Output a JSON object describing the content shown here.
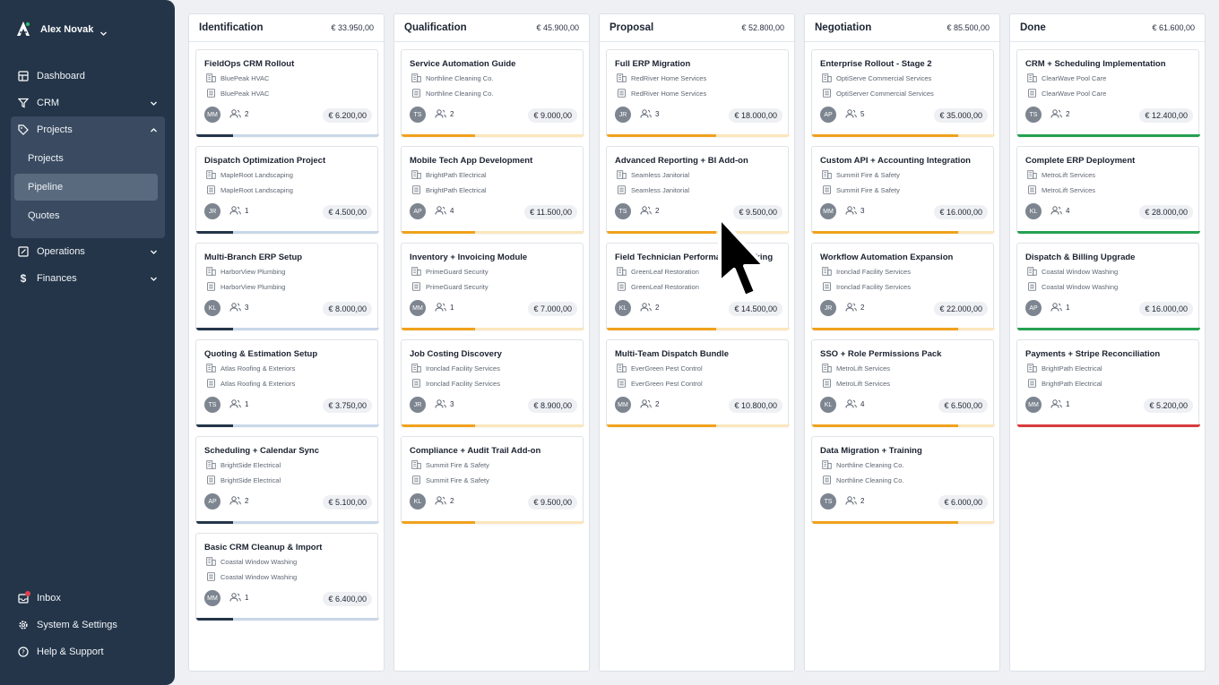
{
  "user": {
    "name": "Alex Novak"
  },
  "nav": [
    {
      "label": "Dashboard",
      "icon": "dashboard-icon"
    },
    {
      "label": "CRM",
      "icon": "filter-icon"
    },
    {
      "label": "Projects",
      "icon": "tag-icon",
      "children": [
        "Projects",
        "Pipeline",
        "Quotes"
      ],
      "active_child": "Pipeline"
    },
    {
      "label": "Operations",
      "icon": "edit-icon"
    },
    {
      "label": "Finances",
      "icon": "dollar-icon"
    }
  ],
  "bottom_nav": [
    {
      "label": "Inbox",
      "icon": "inbox-icon"
    },
    {
      "label": "System & Settings",
      "icon": "gear-icon"
    },
    {
      "label": "Help & Support",
      "icon": "help-icon"
    }
  ],
  "colors": {
    "sidebar": "#243549",
    "dark": "#243549",
    "orange": "#f0a21d",
    "green": "#25a150",
    "red": "#d93a3f"
  },
  "columns": [
    {
      "title": "Identification",
      "total": "€ 33.950,00",
      "cards": [
        {
          "title": "FieldOps CRM Rollout",
          "company": "BluePeak HVAC",
          "contact": "BluePeak HVAC",
          "initials": "MM",
          "people": "2",
          "value": "€ 6.200,00",
          "color": "dark",
          "progress": 0.2
        },
        {
          "title": "Dispatch Optimization Project",
          "company": "MapleRoot Landscaping",
          "contact": "MapleRoot Landscaping",
          "initials": "JR",
          "people": "1",
          "value": "€ 4.500,00",
          "color": "dark",
          "progress": 0.2
        },
        {
          "title": "Multi-Branch ERP Setup",
          "company": "HarborView Plumbing",
          "contact": "HarborView Plumbing",
          "initials": "KL",
          "people": "3",
          "value": "€ 8.000,00",
          "color": "dark",
          "progress": 0.2
        },
        {
          "title": "Quoting & Estimation Setup",
          "company": "Atlas Roofing & Exteriors",
          "contact": "Atlas Roofing & Exteriors",
          "initials": "TS",
          "people": "1",
          "value": "€ 3.750,00",
          "color": "dark",
          "progress": 0.2
        },
        {
          "title": "Scheduling + Calendar Sync",
          "company": "BrightSide Electrical",
          "contact": "BrightSide Electrical",
          "initials": "AP",
          "people": "2",
          "value": "€ 5.100,00",
          "color": "dark",
          "progress": 0.2
        },
        {
          "title": "Basic CRM Cleanup & Import",
          "company": "Coastal Window Washing",
          "contact": "Coastal Window Washing",
          "initials": "MM",
          "people": "1",
          "value": "€ 6.400,00",
          "color": "dark",
          "progress": 0.2
        }
      ]
    },
    {
      "title": "Qualification",
      "total": "€ 45.900,00",
      "cards": [
        {
          "title": "Service Automation Guide",
          "company": "Northline Cleaning Co.",
          "contact": "Northline Cleaning Co.",
          "initials": "TS",
          "people": "2",
          "value": "€ 9.000,00",
          "color": "orange",
          "progress": 0.4
        },
        {
          "title": "Mobile Tech App Development",
          "company": "BrightPath Electrical",
          "contact": "BrightPath Electrical",
          "initials": "AP",
          "people": "4",
          "value": "€ 11.500,00",
          "color": "orange",
          "progress": 0.4
        },
        {
          "title": "Inventory + Invoicing Module",
          "company": "PrimeGuard Security",
          "contact": "PrimeGuard Security",
          "initials": "MM",
          "people": "1",
          "value": "€ 7.000,00",
          "color": "orange",
          "progress": 0.4
        },
        {
          "title": "Job Costing Discovery",
          "company": "Ironclad Facility Services",
          "contact": "Ironclad Facility Services",
          "initials": "JR",
          "people": "3",
          "value": "€ 8.900,00",
          "color": "orange",
          "progress": 0.4
        },
        {
          "title": "Compliance + Audit Trail Add-on",
          "company": "Summit Fire & Safety",
          "contact": "Summit Fire & Safety",
          "initials": "KL",
          "people": "2",
          "value": "€ 9.500,00",
          "color": "orange",
          "progress": 0.4
        }
      ]
    },
    {
      "title": "Proposal",
      "total": "€ 52.800,00",
      "cards": [
        {
          "title": "Full ERP Migration",
          "company": "RedRiver Home Services",
          "contact": "RedRiver Home Services",
          "initials": "JR",
          "people": "3",
          "value": "€ 18.000,00",
          "color": "orange",
          "progress": 0.6
        },
        {
          "title": "Advanced Reporting + BI Add-on",
          "company": "Seamless Janitorial",
          "contact": "Seamless Janitorial",
          "initials": "TS",
          "people": "2",
          "value": "€ 9.500,00",
          "color": "orange",
          "progress": 0.6
        },
        {
          "title": "Field Technician Performance Tracking",
          "company": "GreenLeaf Restoration",
          "contact": "GreenLeaf Restoration",
          "initials": "KL",
          "people": "2",
          "value": "€ 14.500,00",
          "color": "orange",
          "progress": 0.6
        },
        {
          "title": "Multi-Team Dispatch Bundle",
          "company": "EverGreen Pest Control",
          "contact": "EverGreen Pest Control",
          "initials": "MM",
          "people": "2",
          "value": "€ 10.800,00",
          "color": "orange",
          "progress": 0.6
        }
      ]
    },
    {
      "title": "Negotiation",
      "total": "€ 85.500,00",
      "cards": [
        {
          "title": "Enterprise Rollout - Stage 2",
          "company": "OptiServe Commercial Services",
          "contact": "OptiServer Commercial Services",
          "initials": "AP",
          "people": "5",
          "value": "€ 35.000,00",
          "color": "orange",
          "progress": 0.8
        },
        {
          "title": "Custom API + Accounting Integration",
          "company": "Summit Fire & Safety",
          "contact": "Summit Fire & Safety",
          "initials": "MM",
          "people": "3",
          "value": "€ 16.000,00",
          "color": "orange",
          "progress": 0.8
        },
        {
          "title": "Workflow Automation Expansion",
          "company": "Ironclad Facility Services",
          "contact": "Ironclad Facility Services",
          "initials": "JR",
          "people": "2",
          "value": "€ 22.000,00",
          "color": "orange",
          "progress": 0.8
        },
        {
          "title": "SSO + Role Permissions Pack",
          "company": "MetroLift Services",
          "contact": "MetroLift Services",
          "initials": "KL",
          "people": "4",
          "value": "€ 6.500,00",
          "color": "orange",
          "progress": 0.8
        },
        {
          "title": "Data Migration + Training",
          "company": "Northline Cleaning Co.",
          "contact": "Northline Cleaning Co.",
          "initials": "TS",
          "people": "2",
          "value": "€ 6.000,00",
          "color": "orange",
          "progress": 0.8
        }
      ]
    },
    {
      "title": "Done",
      "total": "€ 61.600,00",
      "cards": [
        {
          "title": "CRM + Scheduling Implementation",
          "company": "ClearWave Pool Care",
          "contact": "ClearWave Pool Care",
          "initials": "TS",
          "people": "2",
          "value": "€ 12.400,00",
          "color": "green",
          "progress": 1
        },
        {
          "title": "Complete ERP Deployment",
          "company": "MetroLift Services",
          "contact": "MetroLift Services",
          "initials": "KL",
          "people": "4",
          "value": "€ 28.000,00",
          "color": "green",
          "progress": 1
        },
        {
          "title": "Dispatch & Billing Upgrade",
          "company": "Coastal Window Washing",
          "contact": "Coastal Window Washing",
          "initials": "AP",
          "people": "1",
          "value": "€ 16.000,00",
          "color": "green",
          "progress": 1
        },
        {
          "title": "Payments + Stripe Reconciliation",
          "company": "BrightPath Electrical",
          "contact": "BrightPath Electrical",
          "initials": "MM",
          "people": "1",
          "value": "€ 5.200,00",
          "color": "red",
          "progress": 1
        }
      ]
    }
  ]
}
